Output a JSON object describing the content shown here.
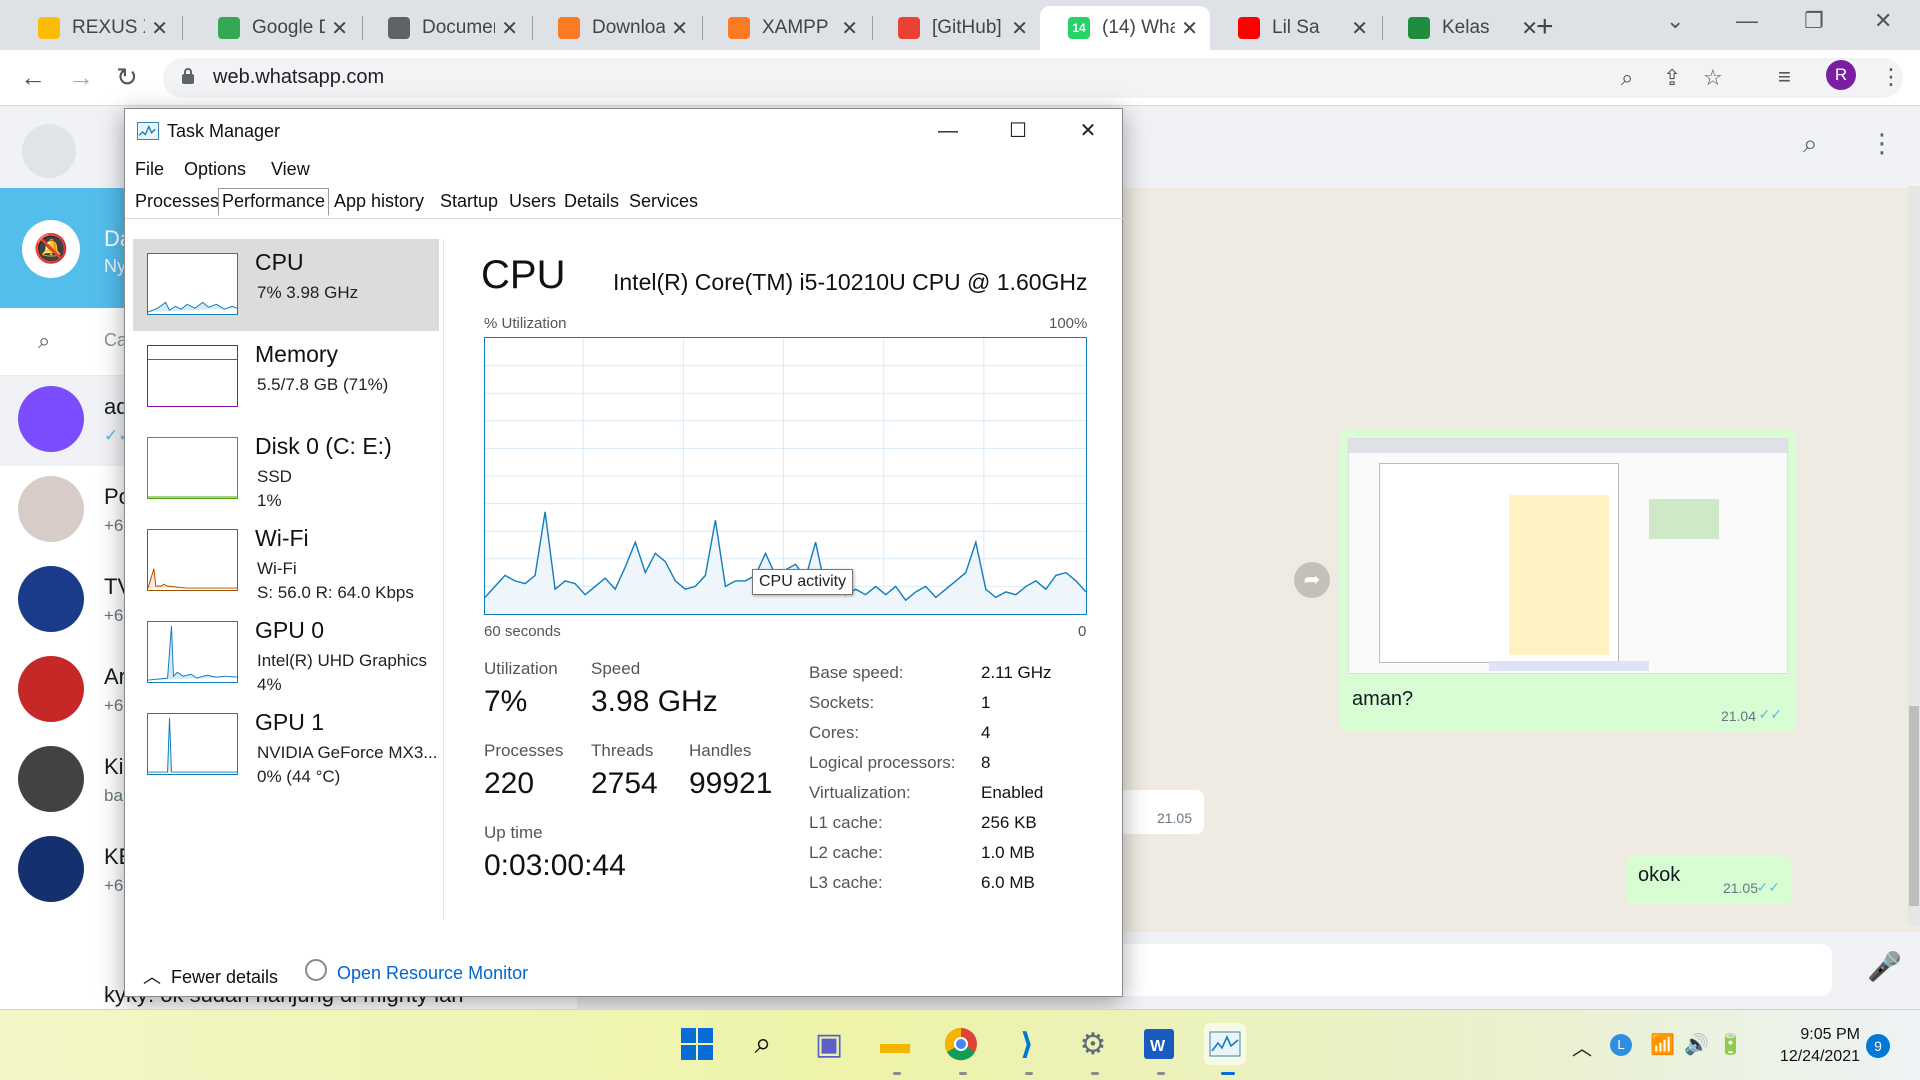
{
  "browser": {
    "tabs": [
      {
        "label": "REXUS X",
        "color": "#fbbc04"
      },
      {
        "label": "Google D",
        "color": "#34a853"
      },
      {
        "label": "Documen",
        "color": "#5f6368"
      },
      {
        "label": "Downloa",
        "color": "#fb7a24"
      },
      {
        "label": "XAMPP I",
        "color": "#fb7a24"
      },
      {
        "label": "[GitHub]",
        "color": "#ea4335"
      },
      {
        "label": "(14) Wha",
        "color": "#25d366",
        "badge": "14"
      },
      {
        "label": "Lil Sa",
        "color": "#ff0000"
      },
      {
        "label": "Kelas",
        "color": "#1e8e3e"
      }
    ],
    "close_glyph": "✕",
    "new_tab": "+",
    "url": "web.whatsapp.com",
    "profile_initial": "R"
  },
  "whatsapp": {
    "banner_title": "Da",
    "banner_sub": "Ny",
    "search_placeholder": "Ca",
    "chats": [
      {
        "name": "ad",
        "sub": "✓✓"
      },
      {
        "name": "Po",
        "sub": "+6"
      },
      {
        "name": "TV",
        "sub": "+6"
      },
      {
        "name": "Ar",
        "sub": "+6"
      },
      {
        "name": "Ki",
        "sub": "ba"
      },
      {
        "name": "KE",
        "sub": "+6"
      }
    ],
    "last_row_text": "kyky: ok sudah nanjung di mighty lah",
    "messages": {
      "image_caption": "aman?",
      "image_time": "21.04",
      "in_time": "21.05",
      "okok": "okok",
      "okok_time": "21.05"
    }
  },
  "taskmgr": {
    "title": "Task Manager",
    "menu": [
      "File",
      "Options",
      "View"
    ],
    "tabs": [
      "Processes",
      "Performance",
      "App history",
      "Startup",
      "Users",
      "Details",
      "Services"
    ],
    "active_tab": "Performance",
    "side": [
      {
        "name": "CPU",
        "l1": "7%  3.98 GHz",
        "l2": "",
        "color": "#117dbb"
      },
      {
        "name": "Memory",
        "l1": "5.5/7.8 GB (71%)",
        "l2": "",
        "color": "#8b12ae"
      },
      {
        "name": "Disk 0 (C: E:)",
        "l1": "SSD",
        "l2": "1%",
        "color": "#4da60c"
      },
      {
        "name": "Wi-Fi",
        "l1": "Wi-Fi",
        "l2": "S: 56.0  R: 64.0 Kbps",
        "color": "#a74f01"
      },
      {
        "name": "GPU 0",
        "l1": "Intel(R) UHD Graphics",
        "l2": "4%",
        "color": "#117dbb"
      },
      {
        "name": "GPU 1",
        "l1": "NVIDIA GeForce MX3...",
        "l2": "0%  (44 °C)",
        "color": "#117dbb"
      }
    ],
    "main": {
      "title": "CPU",
      "model": "Intel(R) Core(TM) i5-10210U CPU @ 1.60GHz",
      "util_label": "% Utilization",
      "util_max": "100%",
      "secs": "60 seconds",
      "zero": "0",
      "tooltip": "CPU activity",
      "stats": {
        "utilization_label": "Utilization",
        "utilization": "7%",
        "speed_label": "Speed",
        "speed": "3.98 GHz",
        "processes_label": "Processes",
        "processes": "220",
        "threads_label": "Threads",
        "threads": "2754",
        "handles_label": "Handles",
        "handles": "99921",
        "uptime_label": "Up time",
        "uptime": "0:03:00:44"
      },
      "specs": [
        {
          "k": "Base speed:",
          "v": "2.11 GHz"
        },
        {
          "k": "Sockets:",
          "v": "1"
        },
        {
          "k": "Cores:",
          "v": "4"
        },
        {
          "k": "Logical processors:",
          "v": "8"
        },
        {
          "k": "Virtualization:",
          "v": "Enabled"
        },
        {
          "k": "L1 cache:",
          "v": "256 KB"
        },
        {
          "k": "L2 cache:",
          "v": "1.0 MB"
        },
        {
          "k": "L3 cache:",
          "v": "6.0 MB"
        }
      ]
    },
    "footer": {
      "fewer": "Fewer details",
      "monitor": "Open Resource Monitor"
    }
  },
  "chart_data": {
    "type": "line",
    "title": "CPU",
    "ylabel": "% Utilization",
    "xlabel": "60 seconds",
    "ylim": [
      0,
      100
    ],
    "x": [
      60,
      59,
      58,
      57,
      56,
      55,
      54,
      53,
      52,
      51,
      50,
      49,
      48,
      47,
      46,
      45,
      44,
      43,
      42,
      41,
      40,
      39,
      38,
      37,
      36,
      35,
      34,
      33,
      32,
      31,
      30,
      29,
      28,
      27,
      26,
      25,
      24,
      23,
      22,
      21,
      20,
      19,
      18,
      17,
      16,
      15,
      14,
      13,
      12,
      11,
      10,
      9,
      8,
      7,
      6,
      5,
      4,
      3,
      2,
      1,
      0
    ],
    "series": [
      {
        "values": [
          6,
          10,
          14,
          12,
          11,
          14,
          37,
          9,
          12,
          11,
          7,
          10,
          13,
          9,
          17,
          26,
          15,
          22,
          19,
          12,
          9,
          10,
          14,
          34,
          10,
          12,
          12,
          14,
          22,
          14,
          16,
          18,
          13,
          26,
          9,
          8,
          7,
          9,
          7,
          10,
          7,
          10,
          5,
          8,
          10,
          6,
          9,
          12,
          15,
          26,
          9,
          6,
          8,
          7,
          10,
          12,
          9,
          14,
          15,
          12,
          8
        ]
      }
    ]
  },
  "taskbar": {
    "time": "9:05 PM",
    "date": "12/24/2021",
    "notifications": "9"
  }
}
